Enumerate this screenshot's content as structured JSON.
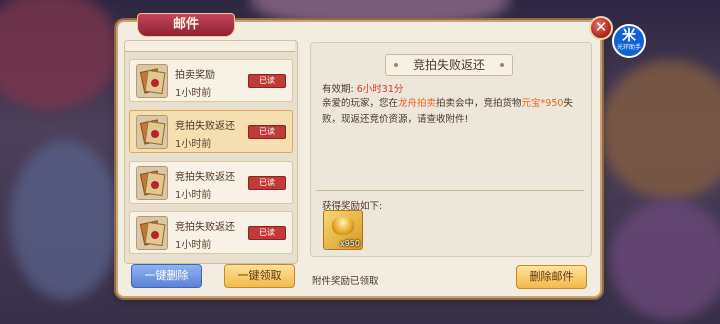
{
  "panel": {
    "title": "邮件"
  },
  "mail_list": [
    {
      "title": "拍卖奖励",
      "time": "1小时前",
      "status": "已读",
      "selected": false
    },
    {
      "title": "竞拍失败返还",
      "time": "1小时前",
      "status": "已读",
      "selected": true
    },
    {
      "title": "竞拍失败返还",
      "time": "1小时前",
      "status": "已读",
      "selected": false
    },
    {
      "title": "竞拍失败返还",
      "time": "1小时前",
      "status": "已读",
      "selected": false
    }
  ],
  "buttons": {
    "delete_all": "一键删除",
    "claim_all": "一键领取",
    "delete_mail": "删除邮件"
  },
  "detail": {
    "title": "竞拍失败返还",
    "validity_label": "有效期:",
    "validity_value": "6小时31分",
    "body_1": "亲爱的玩家，您在",
    "body_hl1": "龙舟拍卖",
    "body_2": "拍卖会中，竞拍货物",
    "body_hl2": "元宝*950",
    "body_3": "失败，现返还竞价资源，请查收附件!",
    "reward_label": "获得奖励如下:",
    "reward_qty": "x950",
    "claimed_note": "附件奖励已领取"
  },
  "assistant": {
    "text": "光环助手"
  },
  "colors": {
    "accent_red": "#c13a3a",
    "highlight_orange": "#e0681c"
  }
}
